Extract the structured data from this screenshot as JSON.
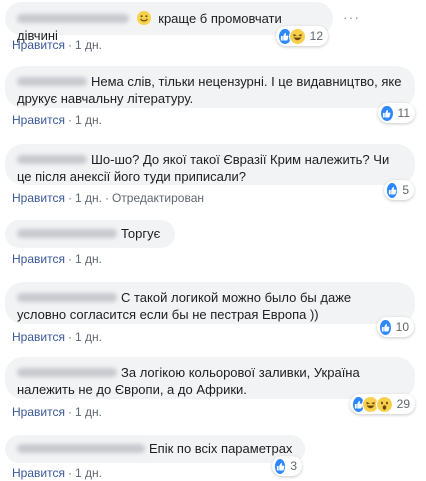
{
  "common": {
    "like_label": "Нравится",
    "edited_label": "Отредактирован",
    "sep": "·"
  },
  "icons": {
    "more": "more-horizontal-icon",
    "like": "like-reaction-icon",
    "haha": "haha-reaction-icon",
    "wow": "wow-reaction-icon"
  },
  "colors": {
    "bubble_bg": "#f2f3f5",
    "like_blue": "#2d88ff",
    "link_blue": "#385898",
    "meta_gray": "#606770"
  },
  "comments": [
    {
      "text": "краще б промовчати дівчині",
      "time": "1 дн.",
      "reactions": "12"
    },
    {
      "text": "Нема слів, тільки нецензурні. І це видавництво, яке друкує навчальну літературу.",
      "time": "1 дн.",
      "reactions": "11"
    },
    {
      "text": "Шо-шо? До якої такої Євразії Крим належить? Чи це після анексії його туди приписали?",
      "time": "1 дн.",
      "reactions": "5"
    },
    {
      "text": "Торгує",
      "time": "1 дн.",
      "reactions": ""
    },
    {
      "text": "С такой логикой можно было бы даже условно согласится если бы не пестрая Европа ))",
      "time": "1 дн.",
      "reactions": "10"
    },
    {
      "text": "За логікою кольорової заливки, Україна належить не до Європи, а до Африки.",
      "time": "1 дн.",
      "reactions": "29"
    },
    {
      "text": "Епік по всіх параметрах",
      "time": "1 дн.",
      "reactions": "3"
    }
  ]
}
